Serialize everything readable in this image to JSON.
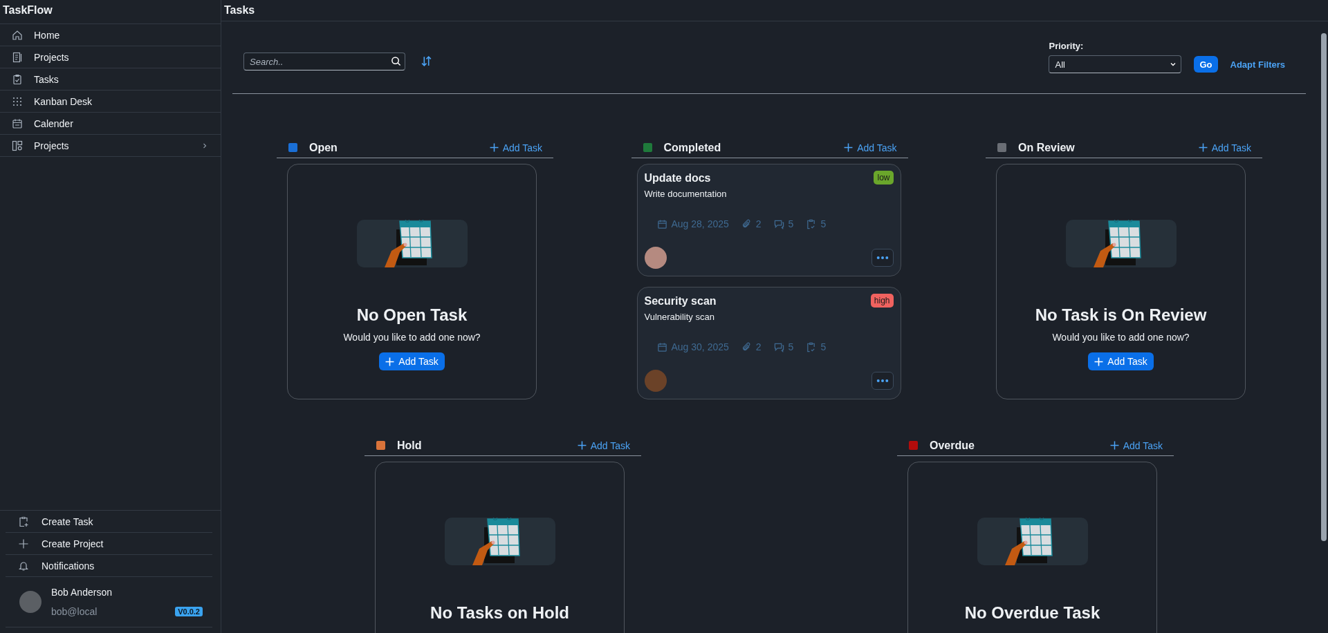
{
  "app": {
    "name": "TaskFlow"
  },
  "sidebar": {
    "items": [
      {
        "label": "Home"
      },
      {
        "label": "Projects"
      },
      {
        "label": "Tasks"
      },
      {
        "label": "Kanban Desk"
      },
      {
        "label": "Calender"
      },
      {
        "label": "Projects",
        "expanded": false
      }
    ],
    "footer_items": [
      "Create Task",
      "Create Project",
      "Notifications"
    ],
    "user": {
      "name": "Bob Anderson",
      "email": "bob@local",
      "version": "V0.0.2"
    }
  },
  "page_title": "Tasks",
  "toolbar": {
    "search_placeholder": "Search..",
    "priority_label": "Priority:",
    "priority_value": "All",
    "go": "Go",
    "adapt_filters": "Adapt Filters"
  },
  "board": {
    "rows": [
      {
        "columns": [
          {
            "name": "Open",
            "color": "#1a6fd6",
            "add": "Add Task",
            "empty": {
              "title": "No Open Task",
              "subtitle": "Would you like to add one now?",
              "button": "Add Task"
            }
          },
          {
            "name": "Completed",
            "color": "#1f7a3b",
            "add": "Add Task",
            "tasks": [
              {
                "title": "Update docs",
                "description": "Write documentation",
                "priority": "low",
                "color": "#6aa62b",
                "date": "Aug 28, 2025",
                "attachments": "2",
                "comments": "5",
                "subtasks": "5"
              },
              {
                "title": "Security scan",
                "description": "Vulnerability scan",
                "priority": "high",
                "color": "#f0625f",
                "date": "Aug 30, 2025",
                "attachments": "2",
                "comments": "5",
                "subtasks": "5"
              }
            ]
          },
          {
            "name": "On Review",
            "color": "#6a6e75",
            "add": "Add Task",
            "empty": {
              "title": "No Task is On Review",
              "subtitle": "Would you like to add one now?",
              "button": "Add Task"
            }
          }
        ]
      },
      {
        "columns": [
          {
            "name": "Hold",
            "color": "#d9733a",
            "add": "Add Task",
            "empty": {
              "title": "No Tasks on Hold"
            }
          },
          {
            "name": "Overdue",
            "color": "#b30c0c",
            "add": "Add Task",
            "empty": {
              "title": "No Overdue Task"
            }
          }
        ]
      }
    ]
  }
}
